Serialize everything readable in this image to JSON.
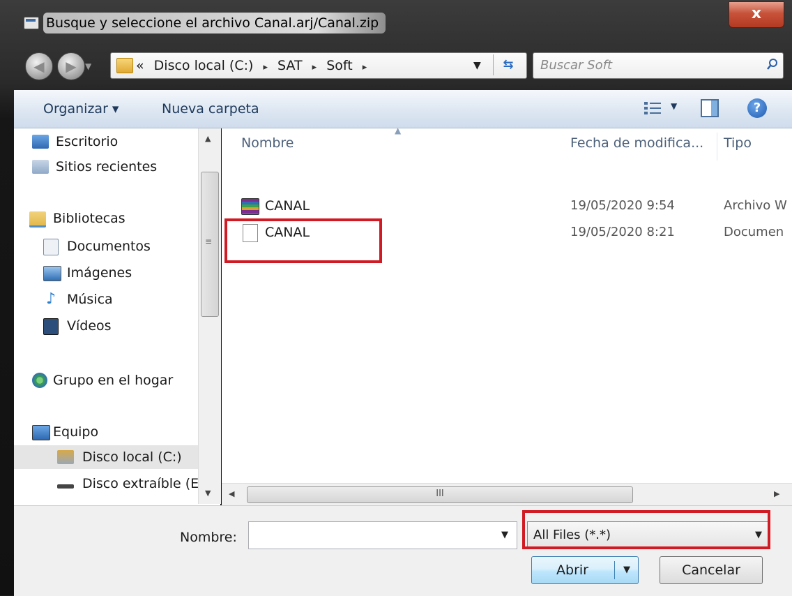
{
  "window": {
    "title": "Busque y seleccione el archivo Canal.arj/Canal.zip",
    "close_glyph": "x"
  },
  "nav": {
    "back_glyph": "◀",
    "forward_glyph": "▶",
    "breadcrumb_prefix": "«",
    "breadcrumbs": [
      "Disco local (C:)",
      "SAT",
      "Soft"
    ],
    "crumb_sep": "▸",
    "search_placeholder": "Buscar Soft"
  },
  "toolbar": {
    "organizar": "Organizar ▾",
    "nueva_carpeta": "Nueva carpeta"
  },
  "sidebar": {
    "items": [
      {
        "label": "Escritorio",
        "icon": "desktop-icon",
        "color": "#3a78c4"
      },
      {
        "label": "Sitios recientes",
        "icon": "recent-places-icon",
        "color": "#8fa9c8"
      },
      {
        "label": "Bibliotecas",
        "icon": "libraries-icon",
        "color": "#e3b94b"
      },
      {
        "label": "Documentos",
        "icon": "documents-icon",
        "color": "#dfe7f0"
      },
      {
        "label": "Imágenes",
        "icon": "pictures-icon",
        "color": "#4f8ec9"
      },
      {
        "label": "Música",
        "icon": "music-icon",
        "color": "#2d7fd0"
      },
      {
        "label": "Vídeos",
        "icon": "videos-icon",
        "color": "#2b4f7a"
      },
      {
        "label": "Grupo en el hogar",
        "icon": "homegroup-icon",
        "color": "#3aa34a"
      },
      {
        "label": "Equipo",
        "icon": "computer-icon",
        "color": "#4b7fc1"
      },
      {
        "label": "Disco local (C:)",
        "icon": "local-disk-icon",
        "color": "#9aa8b6"
      },
      {
        "label": "Disco extraíble (E",
        "icon": "removable-disk-icon",
        "color": "#555555"
      }
    ]
  },
  "files": {
    "columns": [
      "Nombre",
      "Fecha de modifica...",
      "Tipo"
    ],
    "rows": [
      {
        "name": "CANAL",
        "date": "19/05/2020 9:54",
        "type": "Archivo W",
        "icon": "winrar-archive-icon"
      },
      {
        "name": "CANAL",
        "date": "19/05/2020 8:21",
        "type": "Documen",
        "icon": "document-icon"
      }
    ],
    "hscroll_grip": "III"
  },
  "bottom": {
    "name_label": "Nombre:",
    "name_value": "",
    "filter_value": "All Files (*.*)",
    "open_label": "Abrir",
    "cancel_label": "Cancelar"
  },
  "colors": {
    "highlight": "#d11b24",
    "toolbar_text": "#1e395b",
    "header_text": "#4c607a"
  }
}
